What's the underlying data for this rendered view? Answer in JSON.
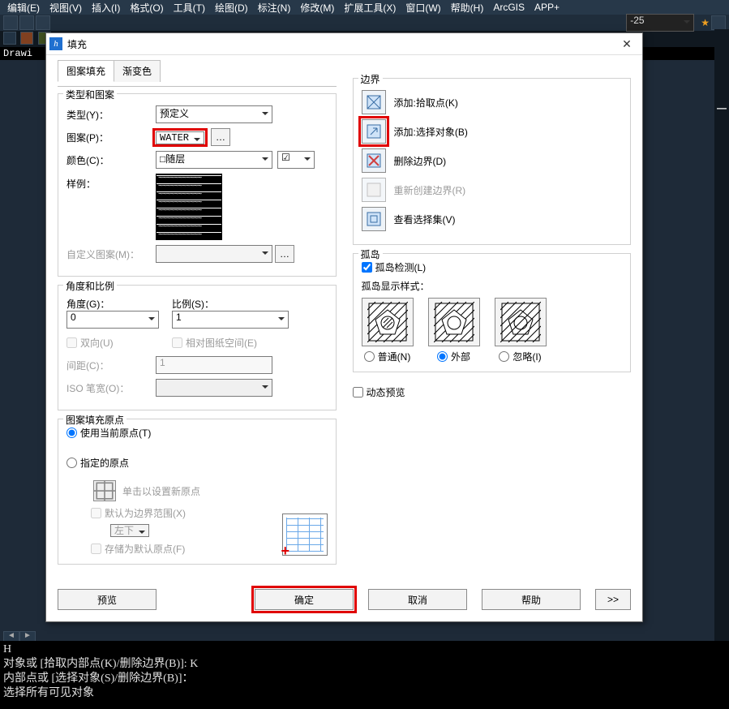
{
  "menubar": [
    "编辑(E)",
    "视图(V)",
    "插入(I)",
    "格式(O)",
    "工具(T)",
    "绘图(D)",
    "标注(N)",
    "修改(M)",
    "扩展工具(X)",
    "窗口(W)",
    "帮助(H)",
    "ArcGIS",
    "APP+"
  ],
  "top_right_combo": "-25",
  "drawing_tab": "Drawi",
  "dialog": {
    "title": "填充",
    "tabs": {
      "pattern": "图案填充",
      "gradient": "渐变色"
    },
    "type_group": {
      "title": "类型和图案",
      "type_label": "类型(Y)：",
      "type_value": "预定义",
      "pattern_label": "图案(P)：",
      "pattern_value": "WATER",
      "color_label": "颜色(C)：",
      "color_value": "□随层",
      "sample_label": "样例：",
      "custom_label": "自定义图案(M)："
    },
    "angle_group": {
      "title": "角度和比例",
      "angle_label": "角度(G)：",
      "angle_value": "0",
      "scale_label": "比例(S)：",
      "scale_value": "1",
      "two_way": "双向(U)",
      "rel_paper": "相对图纸空间(E)",
      "spacing_label": "间距(C)：",
      "spacing_value": "1",
      "iso_label": "ISO 笔宽(O)："
    },
    "origin_group": {
      "title": "图案填充原点",
      "use_current": "使用当前原点(T)",
      "specify": "指定的原点",
      "click_new": "单击以设置新原点",
      "default_extent": "默认为边界范围(X)",
      "pos_value": "左下",
      "store": "存储为默认原点(F)"
    },
    "boundary_group": {
      "title": "边界",
      "add_pick": "添加:拾取点(K)",
      "add_select": "添加:选择对象(B)",
      "del": "删除边界(D)",
      "recreate": "重新创建边界(R)",
      "view_sel": "查看选择集(V)"
    },
    "island_group": {
      "title": "孤岛",
      "detect": "孤岛检测(L)",
      "style_label": "孤岛显示样式：",
      "normal": "普通(N)",
      "outer": "外部",
      "ignore": "忽略(I)"
    },
    "dynamic_preview": "动态预览",
    "buttons": {
      "preview": "预览",
      "ok": "确定",
      "cancel": "取消",
      "help": "帮助",
      "expand": ">>"
    }
  },
  "cmd_lines": [
    "H",
    "对象或 [拾取内部点(K)/删除边界(B)]: K",
    "内部点或 [选择对象(S)/删除边界(B)]：",
    "选择所有可见对象"
  ]
}
